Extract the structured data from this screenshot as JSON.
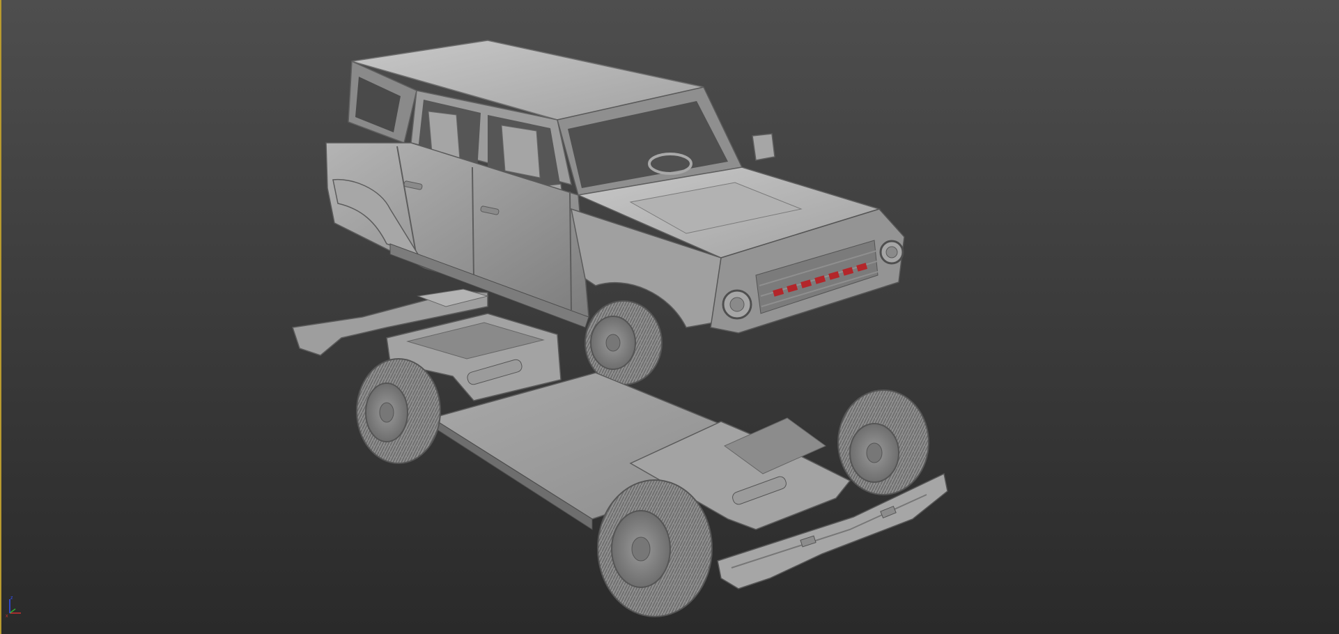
{
  "viewport": {
    "background_top": "#4e4e4e",
    "background_bottom": "#2a2a2a",
    "active_border_color": "#b89a2f",
    "model_color": "#9a9a9a",
    "grille_emblem_color": "#b3262a"
  },
  "axis_gizmo": {
    "x_color": "#d03030",
    "y_color": "#30b030",
    "z_color": "#3050ff"
  }
}
